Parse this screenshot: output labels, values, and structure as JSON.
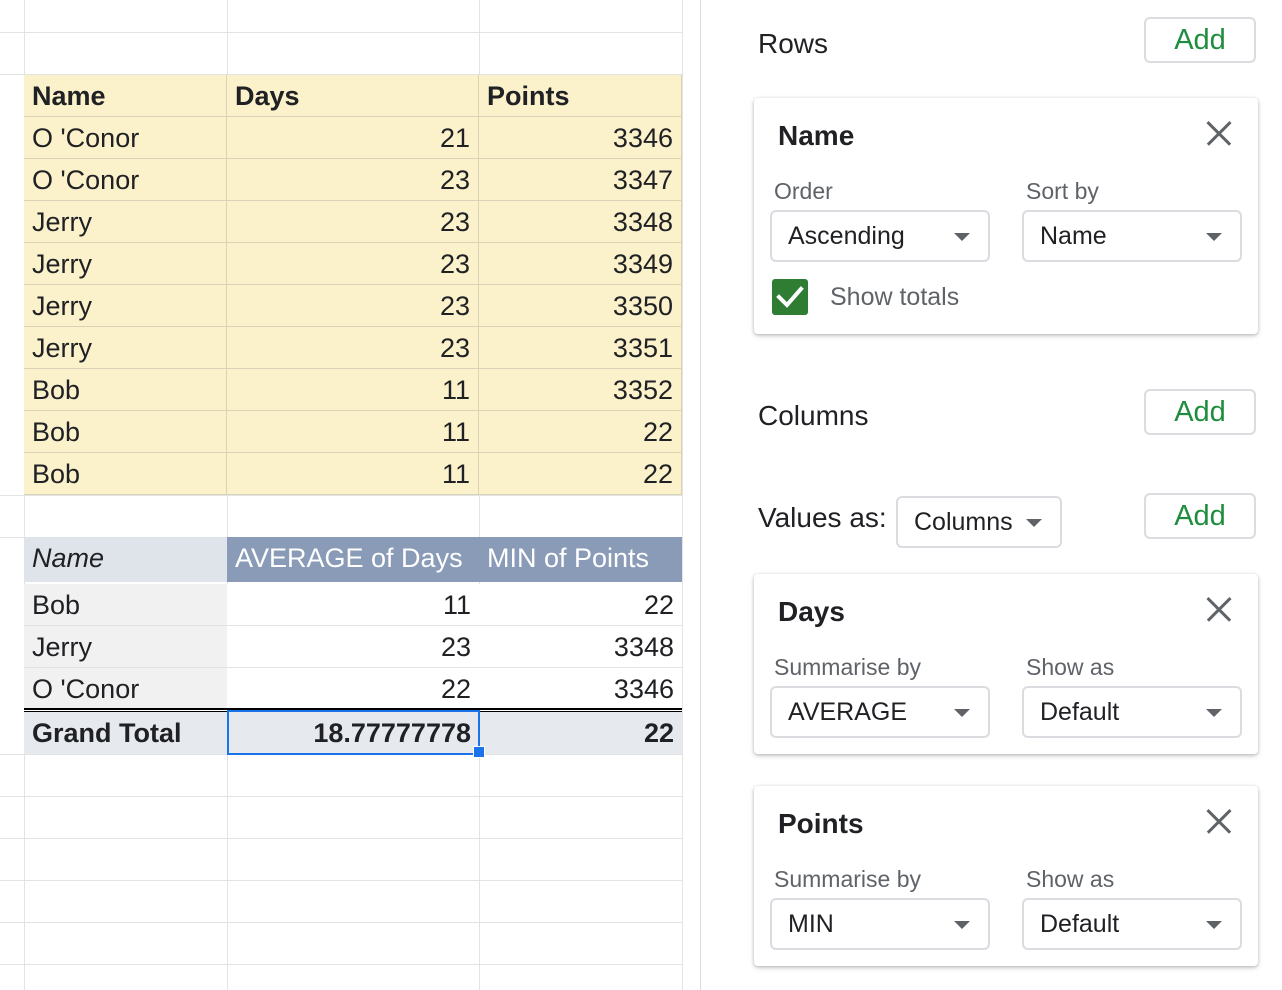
{
  "sheet": {
    "source_headers": [
      "Name",
      "Days",
      "Points"
    ],
    "source_rows": [
      [
        "O 'Conor",
        "21",
        "3346"
      ],
      [
        "O 'Conor",
        "23",
        "3347"
      ],
      [
        "Jerry",
        "23",
        "3348"
      ],
      [
        "Jerry",
        "23",
        "3349"
      ],
      [
        "Jerry",
        "23",
        "3350"
      ],
      [
        "Jerry",
        "23",
        "3351"
      ],
      [
        "Bob",
        "11",
        "3352"
      ],
      [
        "Bob",
        "11",
        "22"
      ],
      [
        "Bob",
        "11",
        "22"
      ]
    ],
    "pivot_headers": [
      "Name",
      "AVERAGE of Days",
      "MIN of Points"
    ],
    "pivot_rows": [
      [
        "Bob",
        "11",
        "22"
      ],
      [
        "Jerry",
        "23",
        "3348"
      ],
      [
        "O 'Conor",
        "22",
        "3346"
      ]
    ],
    "grand_total": [
      "Grand Total",
      "18.77777778",
      "22"
    ],
    "selected_cell_value": "18.77777778"
  },
  "editor": {
    "rows_title": "Rows",
    "columns_title": "Columns",
    "values_as_label": "Values as:",
    "values_as_value": "Columns",
    "add_label": "Add",
    "row_card": {
      "title": "Name",
      "order_label": "Order",
      "order_value": "Ascending",
      "sort_by_label": "Sort by",
      "sort_by_value": "Name",
      "show_totals_label": "Show totals",
      "show_totals_checked": true
    },
    "value_cards": [
      {
        "title": "Days",
        "summarise_label": "Summarise by",
        "summarise_value": "AVERAGE",
        "show_as_label": "Show as",
        "show_as_value": "Default"
      },
      {
        "title": "Points",
        "summarise_label": "Summarise by",
        "summarise_value": "MIN",
        "show_as_label": "Show as",
        "show_as_value": "Default"
      }
    ]
  },
  "colors": {
    "source_fill": "#fbf1cb",
    "pivot_header_fill": "#8a9bb8",
    "selection": "#1a73e8",
    "add_text": "#1e8e3e",
    "checkbox": "#2e7d32"
  }
}
